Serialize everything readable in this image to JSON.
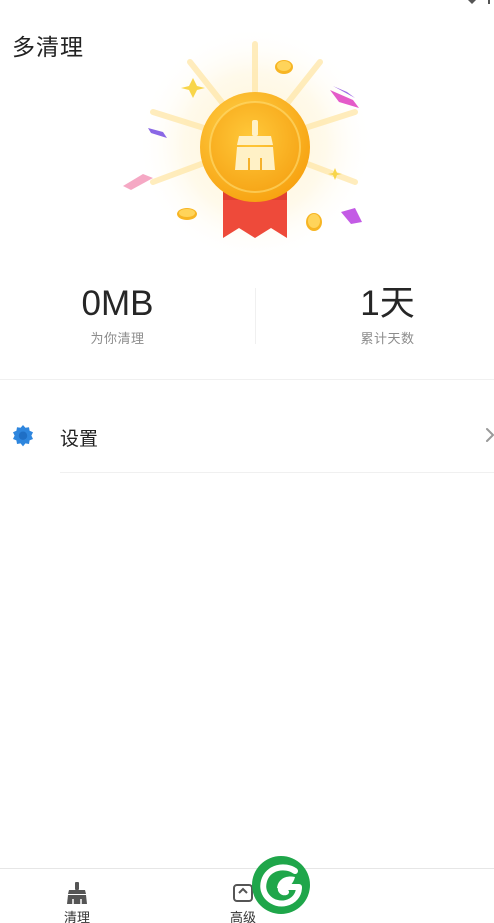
{
  "app": {
    "title": "多清理"
  },
  "stats": {
    "cleaned": {
      "value": "0MB",
      "label": "为你清理"
    },
    "days": {
      "value": "1天",
      "label": "累计天数"
    }
  },
  "settings": {
    "label": "设置",
    "icon": "gear-icon"
  },
  "bottom_nav": {
    "items": [
      {
        "label": "清理",
        "icon": "broom-icon"
      },
      {
        "label": "高级",
        "icon": "advanced-icon"
      }
    ]
  },
  "colors": {
    "medal_gold": "#FFB81C",
    "ribbon_red": "#F0473A",
    "settings_icon": "#2E86DE",
    "watermark_green": "#1FA64A"
  }
}
